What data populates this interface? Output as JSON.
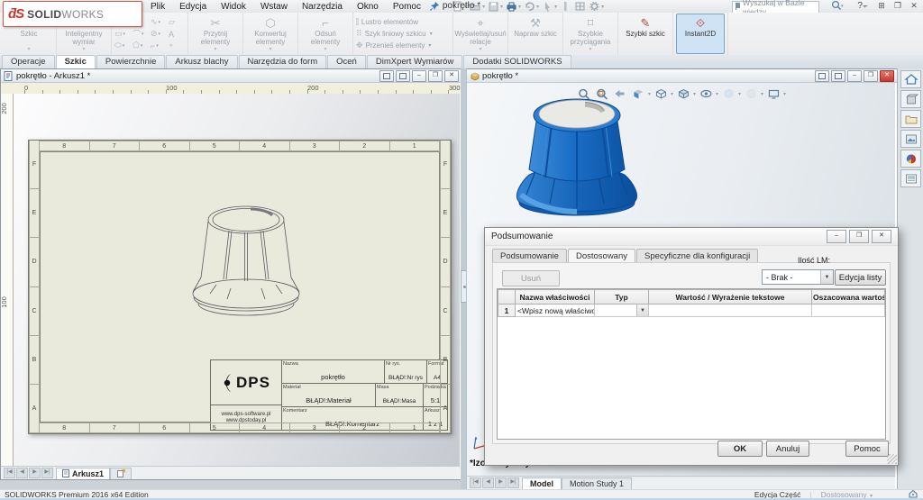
{
  "window": {
    "title": "pokrętło *",
    "search_placeholder": "Wyszukaj w Bazie wiedzy",
    "brand": {
      "ds": "ƌS",
      "solid": "SOLID",
      "works": "WORKS"
    }
  },
  "menus": [
    "Plik",
    "Edycja",
    "Widok",
    "Wstaw",
    "Narzędzia",
    "Okno",
    "Pomoc"
  ],
  "ribbon": {
    "groups": [
      {
        "type": "big",
        "label": "Szkic",
        "icon": "sketch-icon",
        "enabled": false,
        "caret": true
      },
      {
        "type": "big",
        "label": "Inteligentny wymiar",
        "icon": "smart-dimension-icon",
        "enabled": false,
        "caret": true
      },
      {
        "type": "sketchgrid"
      },
      {
        "type": "big",
        "label": "Przytnij elementy",
        "icon": "trim-entities-icon",
        "enabled": false,
        "caret": true
      },
      {
        "type": "big",
        "label": "Konwertuj elementy",
        "icon": "convert-entities-icon",
        "enabled": false,
        "caret": true
      },
      {
        "type": "big",
        "label": "Odsuń elementy",
        "icon": "offset-entities-icon",
        "enabled": false,
        "caret": true
      },
      {
        "type": "stack",
        "items": [
          {
            "label": "Lustro elementów",
            "icon": "mirror-entities-icon",
            "caret": false
          },
          {
            "label": "Szyk liniowy szkicu",
            "icon": "linear-pattern-icon",
            "caret": true
          },
          {
            "label": "Przenieś elementy",
            "icon": "move-entities-icon",
            "caret": true
          }
        ]
      },
      {
        "type": "big",
        "label": "Wyświetlaj/usuń relacje",
        "icon": "display-relations-icon",
        "enabled": false,
        "caret": true
      },
      {
        "type": "big",
        "label": "Napraw szkic",
        "icon": "repair-sketch-icon",
        "enabled": false,
        "caret": false
      },
      {
        "type": "big",
        "label": "Szybkie przyciągania",
        "icon": "quick-snaps-icon",
        "enabled": false,
        "caret": true
      },
      {
        "type": "big",
        "label": "Szybki szkic",
        "icon": "rapid-sketch-icon",
        "enabled": true,
        "caret": false
      },
      {
        "type": "big",
        "label": "Instant2D",
        "icon": "instant2d-icon",
        "enabled": true,
        "selected": true,
        "caret": false
      }
    ]
  },
  "command_tabs": {
    "items": [
      "Operacje",
      "Szkic",
      "Powierzchnie",
      "Arkusz blachy",
      "Narzędzia do form",
      "Oceń",
      "DimXpert Wymiarów",
      "Dodatki SOLIDWORKS"
    ],
    "active_index": 1
  },
  "left_window": {
    "title": "pokrętło - Arkusz1 *",
    "ruler_h_labels": [
      "0",
      "100",
      "200",
      "300"
    ],
    "ruler_v_labels": [
      "200",
      "100"
    ],
    "sheet_tab": "Arkusz1",
    "sheet": {
      "zone_columns": [
        "8",
        "7",
        "6",
        "5",
        "4",
        "3",
        "2",
        "1"
      ],
      "zone_rows": [
        "F",
        "E",
        "D",
        "C",
        "B",
        "A"
      ],
      "titleblock": {
        "logo_text": "DPS",
        "web_line1": "www.dps-software.pl",
        "web_line2": "www.dpstoday.pl",
        "nazwa_label": "Nazwa",
        "nazwa_value": "pokrętło",
        "nrrys_label": "Nr rys.",
        "nrrys_value": "BŁĄD!:Nr rys",
        "format_label": "Format",
        "format_value": "A4",
        "material_label": "Materiał",
        "material_value": "BŁĄD!:Materiał",
        "masa_label": "Masa",
        "masa_value": "BŁĄD!:Masa",
        "podzialka_label": "Podziałka",
        "podzialka_value": "5:1",
        "komentarz_label": "Komentarz",
        "komentarz_value": "BŁĄD!:Komentarz",
        "arkusz_label": "Arkusz",
        "arkusz_value": "1 z 1"
      }
    }
  },
  "right_window": {
    "title": "pokrętło *",
    "view_label": "*Izometryczny",
    "model_tab": "Model",
    "motion_tab": "Motion Study 1"
  },
  "dialog": {
    "title": "Podsumowanie",
    "tabs": [
      "Podsumowanie",
      "Dostosowany",
      "Specyficzne dla konfiguracji"
    ],
    "active_tab_index": 1,
    "delete_button": "Usuń",
    "bom_label": "Ilość LM:",
    "bom_value": "- Brak -",
    "edit_list_button": "Edycja listy",
    "table": {
      "headers": [
        "",
        "Nazwa właściwości",
        "Typ",
        "Wartość / Wyrażenie tekstowe",
        "Oszacowana wartość"
      ],
      "rows": [
        {
          "num": "1",
          "name": "<Wpisz nową właściwość>",
          "typ": "",
          "value": "",
          "evaluated": ""
        }
      ]
    },
    "ok_button": "OK",
    "cancel_button": "Anuluj",
    "help_button": "Pomoc"
  },
  "statusbar": {
    "left_text": "SOLIDWORKS Premium 2016 x64 Edition",
    "mode_text": "Edycja Część",
    "custom_text": "Dostosowany"
  },
  "colors": {
    "knob_blue": "#1668bd",
    "knob_blue_dark": "#0a4a93",
    "knob_light_band": "#5fa9ea",
    "sheet_beige": "#e9e9dc",
    "selected_ribbon_bg": "#cfe3f5",
    "close_red": "#c83b30"
  }
}
